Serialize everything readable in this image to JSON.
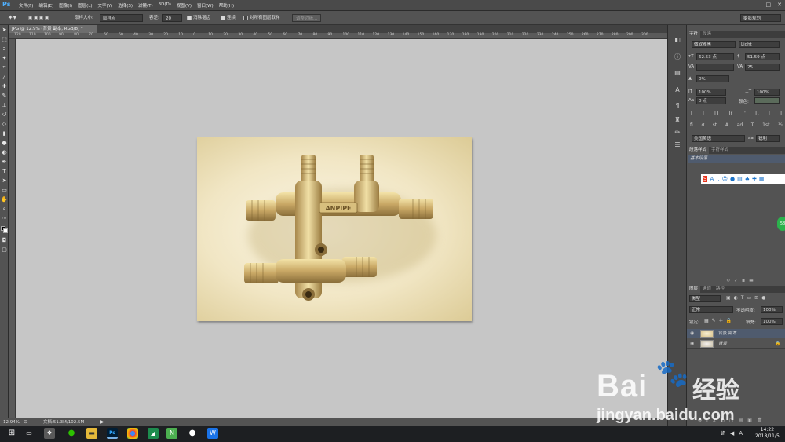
{
  "app": {
    "logo": "Ps"
  },
  "menu": [
    "文件(F)",
    "编辑(E)",
    "图像(I)",
    "图层(L)",
    "文字(Y)",
    "选择(S)",
    "滤镜(T)",
    "3D(D)",
    "视图(V)",
    "窗口(W)",
    "帮助(H)"
  ],
  "window_controls": [
    "–",
    "□",
    "✕"
  ],
  "options": {
    "sample_size_label": "取样大小:",
    "sample_size_value": "取样点",
    "tolerance_label": "容差:",
    "tolerance_value": "20",
    "antialias_label": "消除锯齿",
    "contiguous_label": "连续",
    "all_layers_label": "对所有图层取样",
    "refine_edge_label": "调整边缘...",
    "workspace": "摄影规划"
  },
  "document": {
    "tab_title": "JPG @ 12.9% (背景 副本, RGB/8) *",
    "ruler_ticks": [
      "120",
      "110",
      "100",
      "90",
      "80",
      "70",
      "60",
      "50",
      "40",
      "30",
      "20",
      "10",
      "0",
      "10",
      "20",
      "30",
      "40",
      "50",
      "60",
      "70",
      "80",
      "90",
      "100",
      "110",
      "120",
      "130",
      "140",
      "150",
      "160",
      "170",
      "180",
      "190",
      "200",
      "210",
      "220",
      "230",
      "240",
      "250",
      "260",
      "270",
      "280",
      "290",
      "300"
    ],
    "image_text": "ANPIPE"
  },
  "status": {
    "zoom": "12.94%",
    "doc_size": "文档:51.3M/102.5M"
  },
  "character_panel": {
    "tabs": [
      "字符",
      "段落"
    ],
    "font_family": "微软雅黑",
    "font_style": "Light",
    "font_size": "62.53 点",
    "leading": "51.59 点",
    "kerning": "",
    "tracking": "25",
    "baseline_scale": "0%",
    "vertical_scale": "100%",
    "horizontal_scale": "100%",
    "baseline_shift": "0 点",
    "color_label": "颜色:",
    "type_buttons": [
      "T",
      "T",
      "TT",
      "Tr",
      "T'",
      "T,",
      "T",
      "T"
    ],
    "opentype_buttons": [
      "fi",
      "ơ",
      "st",
      "A",
      "ad",
      "T",
      "1st",
      "½"
    ],
    "language": "美国英语",
    "antialias": "锐利",
    "aa_label": "aa"
  },
  "paragraph_styles": {
    "tabs": [
      "段落样式",
      "字符样式"
    ],
    "item": "基本段落"
  },
  "layers_panel": {
    "tabs": [
      "图层",
      "通道",
      "路径"
    ],
    "filter_kind": "类型",
    "blend_mode": "正常",
    "opacity_label": "不透明度:",
    "opacity": "100%",
    "lock_label": "锁定:",
    "fill_label": "填充:",
    "fill": "100%",
    "layers": [
      {
        "name": "背景 副本",
        "selected": true
      },
      {
        "name": "背景",
        "selected": false
      }
    ]
  },
  "taskbar": {
    "time": "14:22",
    "date": "2018/11/5",
    "lang": "A"
  },
  "watermark": {
    "brand": "Bai",
    "brand2": "经验",
    "url": "jingyan.baidu.com"
  },
  "sogou_badge": "58",
  "colors": {
    "accent": "#4fb0ff",
    "selected_layer": "#4f5b6e"
  }
}
